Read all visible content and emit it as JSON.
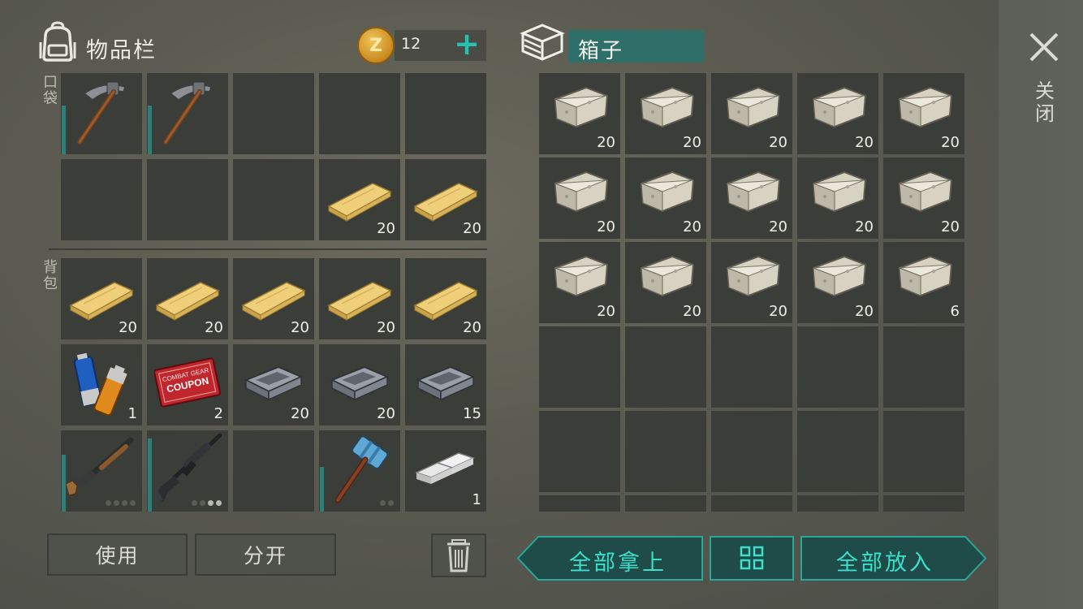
{
  "inventory": {
    "title": "物品栏",
    "coins": "12",
    "pocket_label": "口袋",
    "backpack_label": "背包",
    "pocket_slots": [
      {
        "item": "pickaxe",
        "qty": "",
        "durability": 0.6
      },
      {
        "item": "pickaxe",
        "qty": "",
        "durability": 0.6
      },
      {
        "item": "",
        "qty": ""
      },
      {
        "item": "",
        "qty": ""
      },
      {
        "item": "",
        "qty": ""
      },
      {
        "item": "",
        "qty": ""
      },
      {
        "item": "",
        "qty": ""
      },
      {
        "item": "",
        "qty": ""
      },
      {
        "item": "plank",
        "qty": "20"
      },
      {
        "item": "plank",
        "qty": "20"
      }
    ],
    "backpack_slots": [
      {
        "item": "plank",
        "qty": "20"
      },
      {
        "item": "plank",
        "qty": "20"
      },
      {
        "item": "plank",
        "qty": "20"
      },
      {
        "item": "plank",
        "qty": "20"
      },
      {
        "item": "plank",
        "qty": "20"
      },
      {
        "item": "batteries",
        "qty": "1"
      },
      {
        "item": "coupon",
        "qty": "2",
        "coupon_text_1": "COMBAT GEAR",
        "coupon_text_2": "COUPON"
      },
      {
        "item": "iron-ingot",
        "qty": "20"
      },
      {
        "item": "iron-ingot",
        "qty": "20"
      },
      {
        "item": "iron-ingot",
        "qty": "15"
      },
      {
        "item": "shotgun",
        "qty": "",
        "durability": 0.7,
        "dots": [
          false,
          false,
          false,
          false
        ]
      },
      {
        "item": "rifle",
        "qty": "",
        "durability": 0.9,
        "dots": [
          false,
          false,
          true,
          true
        ]
      },
      {
        "item": "",
        "qty": ""
      },
      {
        "item": "sledgehammer",
        "qty": "",
        "durability": 0.55,
        "dots": [
          false,
          false
        ]
      },
      {
        "item": "metal-bars",
        "qty": "1"
      }
    ]
  },
  "box": {
    "title": "箱子",
    "slots": [
      {
        "item": "stone",
        "qty": "20"
      },
      {
        "item": "stone",
        "qty": "20"
      },
      {
        "item": "stone",
        "qty": "20"
      },
      {
        "item": "stone",
        "qty": "20"
      },
      {
        "item": "stone",
        "qty": "20"
      },
      {
        "item": "stone",
        "qty": "20"
      },
      {
        "item": "stone",
        "qty": "20"
      },
      {
        "item": "stone",
        "qty": "20"
      },
      {
        "item": "stone",
        "qty": "20"
      },
      {
        "item": "stone",
        "qty": "20"
      },
      {
        "item": "stone",
        "qty": "20"
      },
      {
        "item": "stone",
        "qty": "20"
      },
      {
        "item": "stone",
        "qty": "20"
      },
      {
        "item": "stone",
        "qty": "20"
      },
      {
        "item": "stone",
        "qty": "6"
      },
      {
        "item": "",
        "qty": ""
      },
      {
        "item": "",
        "qty": ""
      },
      {
        "item": "",
        "qty": ""
      },
      {
        "item": "",
        "qty": ""
      },
      {
        "item": "",
        "qty": ""
      },
      {
        "item": "",
        "qty": ""
      },
      {
        "item": "",
        "qty": ""
      },
      {
        "item": "",
        "qty": ""
      },
      {
        "item": "",
        "qty": ""
      },
      {
        "item": "",
        "qty": ""
      }
    ]
  },
  "close_label": "关闭",
  "buttons": {
    "use": "使用",
    "split": "分开",
    "take_all": "全部拿上",
    "put_all": "全部放入"
  },
  "colors": {
    "accent": "#26c2b0",
    "slot": "#3b3d38",
    "durability": "#2d7f79",
    "teal_button": "#1f4b48"
  }
}
